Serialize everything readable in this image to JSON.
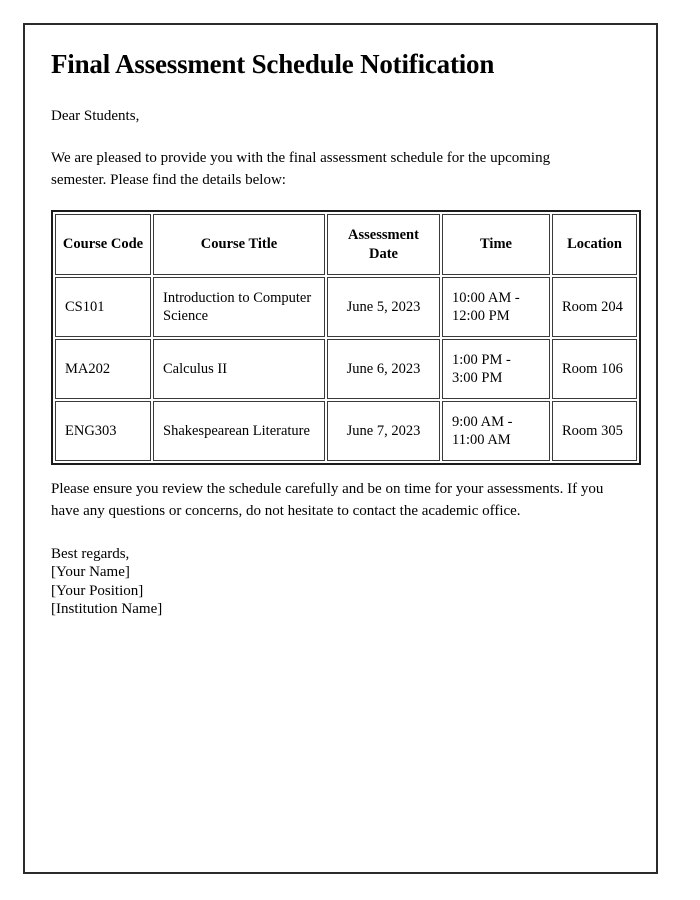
{
  "document": {
    "title": "Final Assessment Schedule Notification",
    "salutation": "Dear Students,",
    "intro_paragraph": "We are pleased to provide you with the final assessment schedule for the upcoming semester. Please find the details below:",
    "closing_paragraph": "Please ensure you review the schedule carefully and be on time for your assessments. If you have any questions or concerns, do not hesitate to contact the academic office.",
    "signature": {
      "closing": "Best regards,",
      "name": "[Your Name]",
      "position": "[Your Position]",
      "institution": "[Institution Name]"
    }
  },
  "table": {
    "headers": {
      "course_code": "Course Code",
      "course_title": "Course Title",
      "assessment_date": "Assessment Date",
      "time": "Time",
      "location": "Location"
    },
    "rows": [
      {
        "course_code": "CS101",
        "course_title": "Introduction to Computer Science",
        "assessment_date": "June 5, 2023",
        "time": "10:00 AM - 12:00 PM",
        "location": "Room 204"
      },
      {
        "course_code": "MA202",
        "course_title": "Calculus II",
        "assessment_date": "June 6, 2023",
        "time": "1:00 PM - 3:00 PM",
        "location": "Room 106"
      },
      {
        "course_code": "ENG303",
        "course_title": "Shakespearean Literature",
        "assessment_date": "June 7, 2023",
        "time": "9:00 AM - 11:00 AM",
        "location": "Room 305"
      }
    ]
  },
  "colors": {
    "page_background": "#ffffff",
    "text": "#000000",
    "page_border": "#2b2b2b",
    "table_border": "#1c1c1c",
    "cell_border": "#3a3a3a"
  }
}
